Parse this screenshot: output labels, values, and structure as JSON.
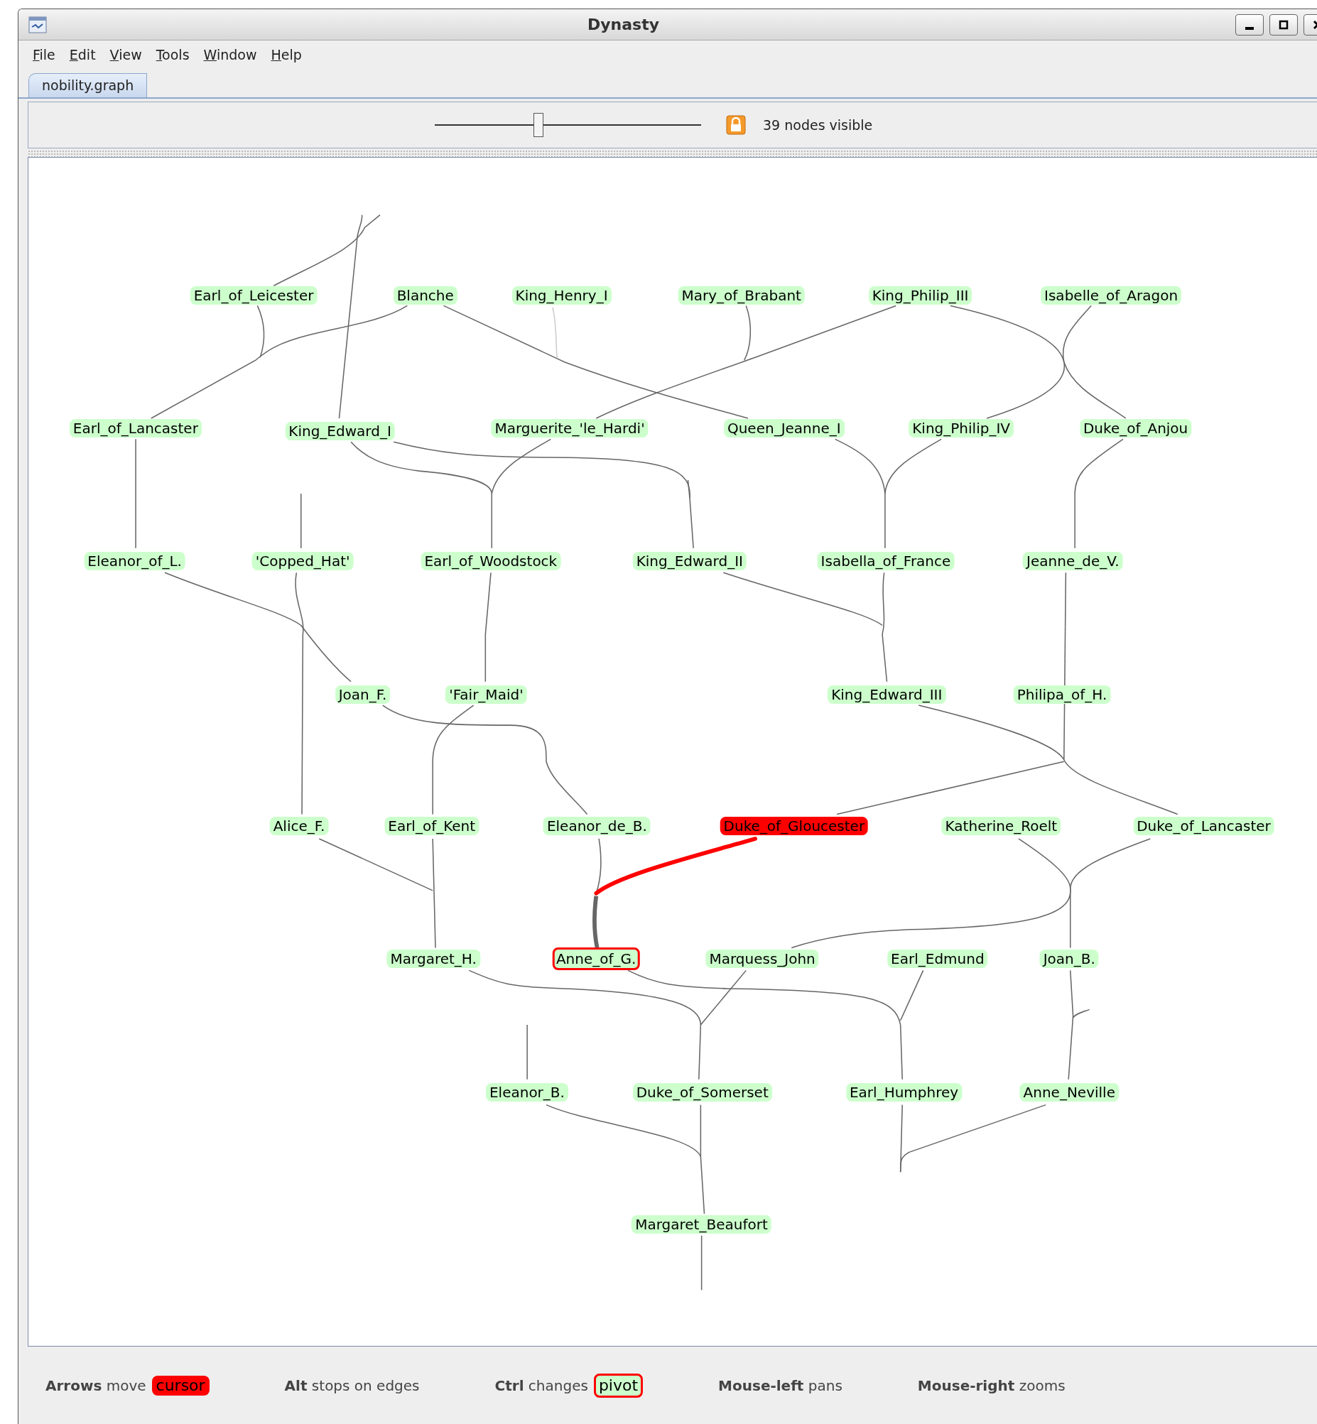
{
  "window": {
    "title": "Dynasty"
  },
  "menu": [
    "File",
    "Edit",
    "View",
    "Tools",
    "Window",
    "Help"
  ],
  "tabs": [
    {
      "label": "nobility.graph",
      "selected": true
    }
  ],
  "toolbar": {
    "zoom_slider": {
      "level": 0.39
    },
    "locked": true,
    "status": "39 nodes visible"
  },
  "graph": {
    "nodes": [
      {
        "label": "Earl_of_Leicester",
        "cursor": false,
        "pivot": false
      },
      {
        "label": "Blanche",
        "cursor": false,
        "pivot": false
      },
      {
        "label": "King_Henry_I",
        "cursor": false,
        "pivot": false
      },
      {
        "label": "Mary_of_Brabant",
        "cursor": false,
        "pivot": false
      },
      {
        "label": "King_Philip_III",
        "cursor": false,
        "pivot": false
      },
      {
        "label": "Isabelle_of_Aragon",
        "cursor": false,
        "pivot": false
      },
      {
        "label": "Earl_of_Lancaster",
        "cursor": false,
        "pivot": false
      },
      {
        "label": "King_Edward_I",
        "cursor": false,
        "pivot": false
      },
      {
        "label": "Marguerite_'le_Hardi'",
        "cursor": false,
        "pivot": false
      },
      {
        "label": "Queen_Jeanne_I",
        "cursor": false,
        "pivot": false
      },
      {
        "label": "King_Philip_IV",
        "cursor": false,
        "pivot": false
      },
      {
        "label": "Duke_of_Anjou",
        "cursor": false,
        "pivot": false
      },
      {
        "label": "Eleanor_of_L.",
        "cursor": false,
        "pivot": false
      },
      {
        "label": "'Copped_Hat'",
        "cursor": false,
        "pivot": false
      },
      {
        "label": "Earl_of_Woodstock",
        "cursor": false,
        "pivot": false
      },
      {
        "label": "King_Edward_II",
        "cursor": false,
        "pivot": false
      },
      {
        "label": "Isabella_of_France",
        "cursor": false,
        "pivot": false
      },
      {
        "label": "Jeanne_de_V.",
        "cursor": false,
        "pivot": false
      },
      {
        "label": "Joan_F.",
        "cursor": false,
        "pivot": false
      },
      {
        "label": "'Fair_Maid'",
        "cursor": false,
        "pivot": false
      },
      {
        "label": "King_Edward_III",
        "cursor": false,
        "pivot": false
      },
      {
        "label": "Philipa_of_H.",
        "cursor": false,
        "pivot": false
      },
      {
        "label": "Alice_F.",
        "cursor": false,
        "pivot": false
      },
      {
        "label": "Earl_of_Kent",
        "cursor": false,
        "pivot": false
      },
      {
        "label": "Eleanor_de_B.",
        "cursor": false,
        "pivot": false
      },
      {
        "label": "Duke_of_Gloucester",
        "cursor": true,
        "pivot": false
      },
      {
        "label": "Katherine_Roelt",
        "cursor": false,
        "pivot": false
      },
      {
        "label": "Duke_of_Lancaster",
        "cursor": false,
        "pivot": false
      },
      {
        "label": "Margaret_H.",
        "cursor": false,
        "pivot": false
      },
      {
        "label": "Anne_of_G.",
        "cursor": false,
        "pivot": true
      },
      {
        "label": "Marquess_John",
        "cursor": false,
        "pivot": false
      },
      {
        "label": "Earl_Edmund",
        "cursor": false,
        "pivot": false
      },
      {
        "label": "Joan_B.",
        "cursor": false,
        "pivot": false
      },
      {
        "label": "Eleanor_B.",
        "cursor": false,
        "pivot": false
      },
      {
        "label": "Duke_of_Somerset",
        "cursor": false,
        "pivot": false
      },
      {
        "label": "Earl_Humphrey",
        "cursor": false,
        "pivot": false
      },
      {
        "label": "Anne_Neville",
        "cursor": false,
        "pivot": false
      },
      {
        "label": "Margaret_Beaufort",
        "cursor": false,
        "pivot": false
      }
    ]
  },
  "hints": [
    {
      "key": "Arrows",
      "action": "move",
      "badge": {
        "text": "cursor",
        "kind": "cursor"
      }
    },
    {
      "key": "Alt",
      "action": "stops on edges"
    },
    {
      "key": "Ctrl",
      "action": "changes",
      "badge": {
        "text": "pivot",
        "kind": "pivot"
      }
    },
    {
      "key": "Mouse-left",
      "action": "pans"
    },
    {
      "key": "Mouse-right",
      "action": "zooms"
    }
  ]
}
